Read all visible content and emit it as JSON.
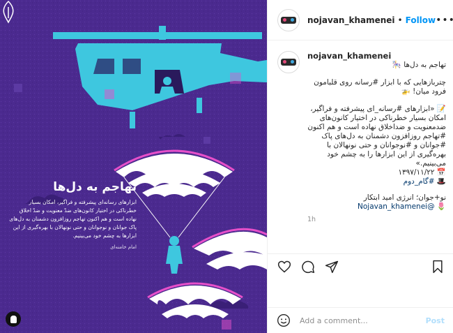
{
  "poster": {
    "title": "تهاجم به دل‌ها",
    "body": "ابزارهای رسانه‌ای پیشرفته و فراگیر، امکان بسیار خطرناکی در اختیار کانون‌های ضدّ معنویت و ضدّ اخلاق نهاده است و هم اکنون تهاجم روزافزون دشمنان به دل‌های پاک جوانان و نوجوانان و حتی نونهالان با بهره‌گیری از این ابزارها به چشم خود می‌بینیم.",
    "signature": "امام خامنه‌ای",
    "colors": {
      "background": "#4b2a8f",
      "accent": "#3ec7df",
      "highlight": "#e64fc9"
    }
  },
  "header": {
    "username": "nojavan_khamenei",
    "separator": "•",
    "follow_label": "Follow",
    "more_label": "•••"
  },
  "caption": {
    "username": "nojavan_khamenei",
    "line1": "تهاجم به دل‌ها 🎠",
    "para2": "چترباز‌هایی که با ابزار #رسانه روی قلبامون فرود میان! 🚁",
    "para3": "📝 «ابزارهای #رسانه_ای پیشرفته و فراگیر، امکان بسیار خطرناکی در اختیار کانون‌های ضدمعنویت و ضداخلاق نهاده است و هم اکنون #تهاجم روزافزون دشمنان به دل‌های پاک #جوانان و #نوجوانان و حتی نونهالان با بهره‌گیری از این ابزارها را به چشم خود می‌بینیم.»",
    "date": "📅 ۱۳۹۷/۱۱/۲۲",
    "tag_line": "🎩 #گام_دوم",
    "credit": "نو+جوان؛ انرژی امید ابتکار",
    "handle": "🌷 @Nojavan_khamenei",
    "time": "1h"
  },
  "actions": {
    "like_icon": "heart-icon",
    "comment_icon": "comment-icon",
    "share_icon": "share-icon",
    "save_icon": "bookmark-icon"
  },
  "comment_box": {
    "placeholder": "Add a comment...",
    "post_label": "Post",
    "emoji_icon": "emoji-icon"
  },
  "colors": {
    "link": "#0095f6",
    "hashtag": "#00376b",
    "muted": "#8e8e8e",
    "border": "#efefef"
  }
}
